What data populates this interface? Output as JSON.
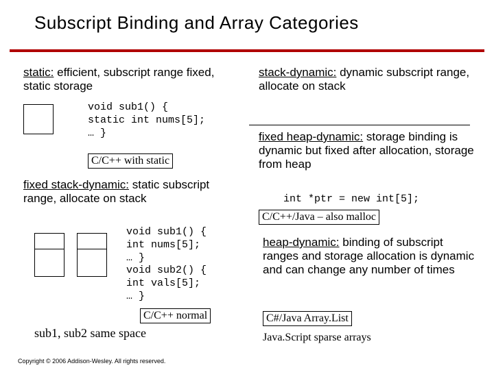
{
  "title": "Subscript Binding and Array Categories",
  "left": {
    "static": {
      "em": "static:",
      "rest": " efficient, subscript range fixed, static storage",
      "code": "void sub1() {\nstatic int nums[5];\n… }",
      "cap": "C/C++ with static"
    },
    "fixed_stack": {
      "em": "fixed stack-dynamic:",
      "rest": " static subscript range, allocate on stack",
      "code": "void sub1() {\nint nums[5];\n… }\nvoid sub2() {\nint vals[5];\n… }",
      "cap": "C/C++ normal",
      "note": "sub1, sub2 same space"
    }
  },
  "right": {
    "stack_dynamic": {
      "em": "stack-dynamic:",
      "rest": " dynamic subscript range, allocate on stack"
    },
    "fixed_heap": {
      "em": "fixed heap-dynamic:",
      "rest": " storage binding is dynamic but fixed after allocation, storage from heap",
      "code": "int *ptr = new int[5];",
      "cap": "C/C++/Java – also malloc"
    },
    "heap_dynamic": {
      "em": "heap-dynamic:",
      "rest": " binding of subscript ranges and storage allocation is dynamic and can change any number of times",
      "caps": {
        "a": "C#/Java Array.List",
        "b": "Java.Script sparse arrays"
      }
    }
  },
  "footer": "Copyright © 2006 Addison-Wesley. All rights reserved."
}
